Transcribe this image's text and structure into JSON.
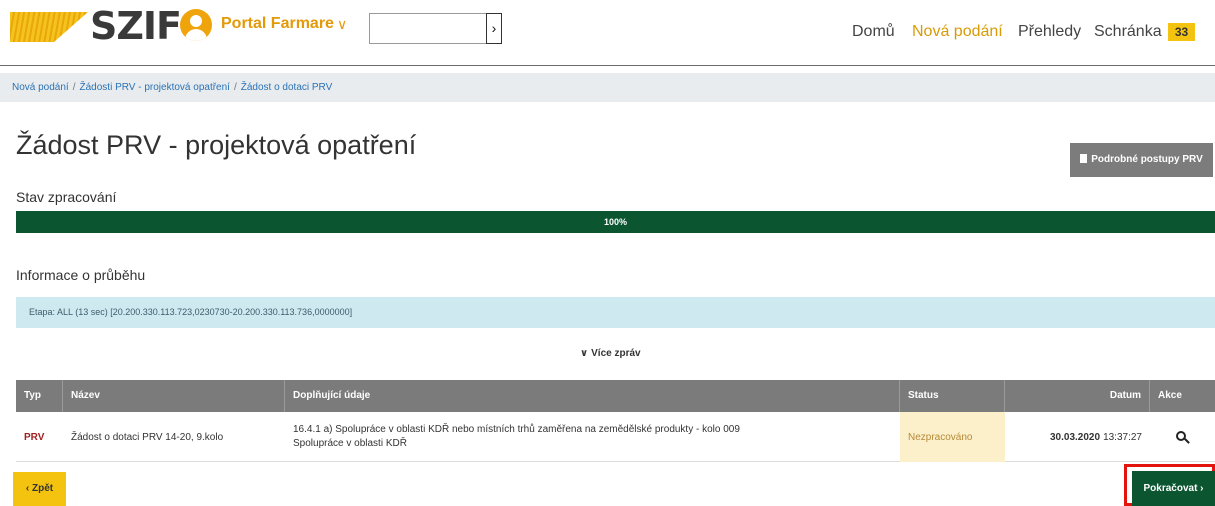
{
  "header": {
    "logo_text": "SZIF",
    "portal_label": "Portal Farmare",
    "portal_chevron": "∨",
    "search_value": "",
    "search_button": "›",
    "nav": {
      "domu": "Domů",
      "nova_podani": "Nová podání",
      "prehledy": "Přehledy",
      "schranka": "Schránka",
      "schranka_count": "33"
    }
  },
  "breadcrumb": {
    "items": [
      "Nová podání",
      "Žádosti PRV - projektová opatření",
      "Žádost o dotaci PRV"
    ],
    "separator": "/"
  },
  "page": {
    "title": "Žádost PRV - projektová opatření",
    "guide_button": "Podrobné postupy PRV",
    "status_label": "Stav zpracování",
    "progress": {
      "percent": 100,
      "label": "100%"
    },
    "info_label": "Informace o průběhu",
    "stage_text": "Etapa: ALL (13 sec) [20.200.330.113.723,0230730-20.200.330.113.736,0000000]",
    "more_messages": "Více zpráv",
    "more_messages_icon": "chevron-down"
  },
  "table": {
    "headers": [
      "Typ",
      "Název",
      "Doplňující údaje",
      "Status",
      "Datum",
      "Akce"
    ],
    "rows": [
      {
        "typ": "PRV",
        "nazev": "Žádost o dotaci PRV 14-20, 9.kolo",
        "doplnujici_1": "16.4.1 a) Spolupráce v oblasti KDŘ nebo místních trhů zaměřena na zemědělské produkty - kolo 009",
        "doplnujici_2": "Spolupráce v oblasti KDŘ",
        "status": "Nezpracováno",
        "datum_date": "30.03.2020",
        "datum_time": "13:37:27",
        "akce_icon": "search-icon"
      }
    ]
  },
  "buttons": {
    "back": "‹ Zpět",
    "continue": "Pokračovat ›"
  },
  "colors": {
    "brand_yellow": "#f4c310",
    "brand_orange": "#e39a0a",
    "progress_green": "#0b5531",
    "stage_bg": "#cfe9f0",
    "table_header": "#7b7b7b",
    "status_bg": "#fbf0c9",
    "highlight_red": "#e3140e"
  }
}
